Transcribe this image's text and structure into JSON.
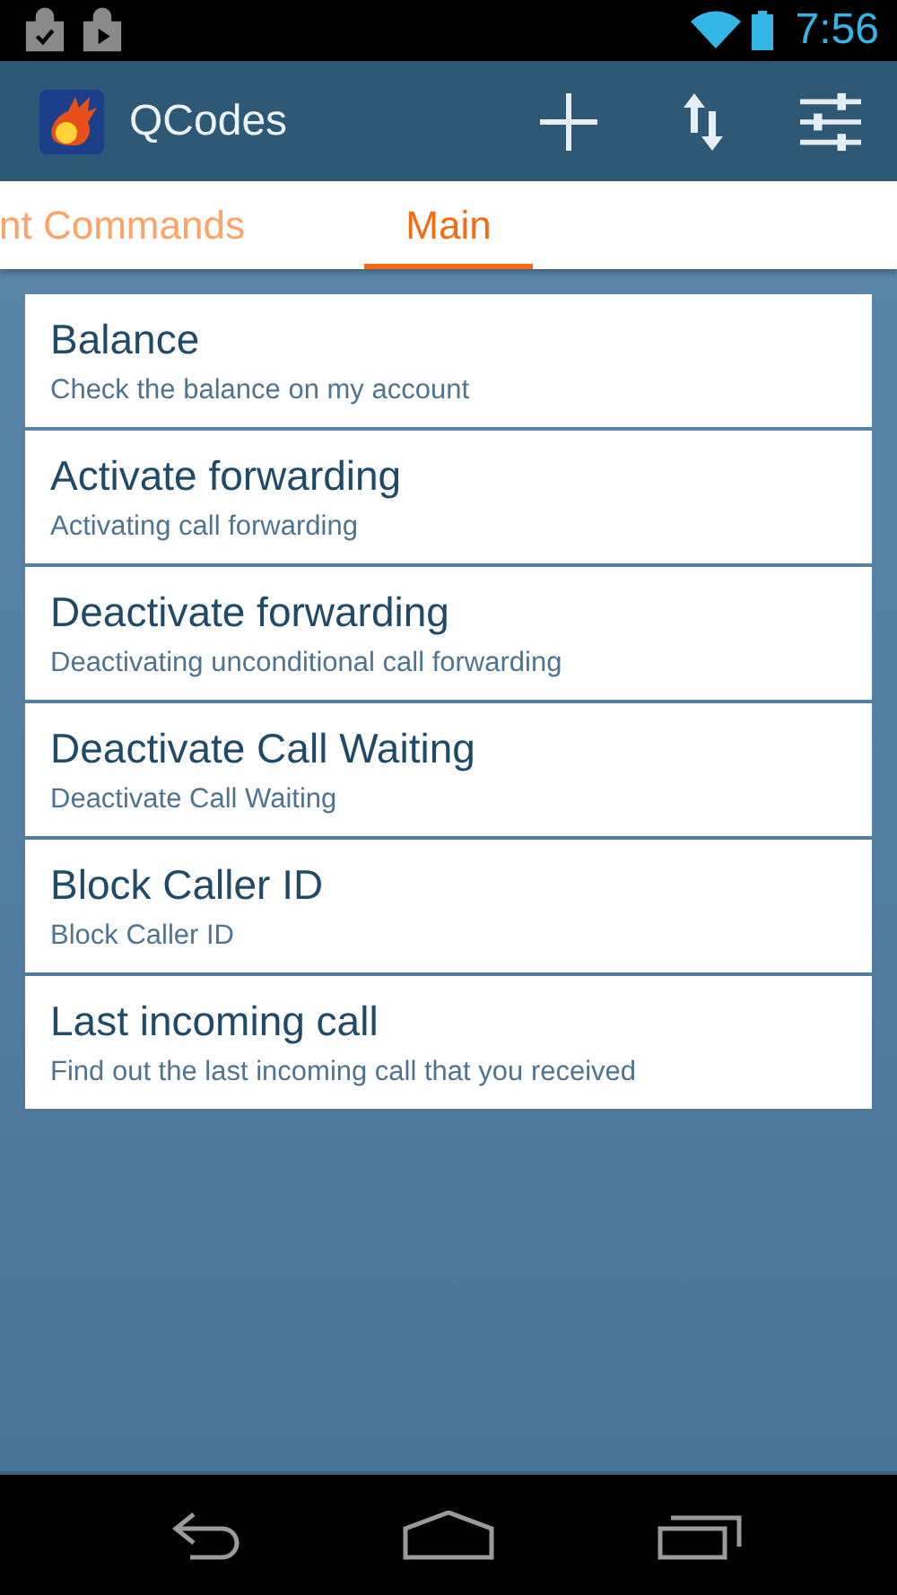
{
  "status_bar": {
    "time": "7:56"
  },
  "app_bar": {
    "title": "QCodes"
  },
  "tabs": [
    {
      "label": "nt Commands",
      "selected": false
    },
    {
      "label": "Main",
      "selected": true
    }
  ],
  "commands": [
    {
      "title": "Balance",
      "subtitle": "Check the balance on my account"
    },
    {
      "title": "Activate forwarding",
      "subtitle": "Activating call forwarding"
    },
    {
      "title": "Deactivate forwarding",
      "subtitle": "Deactivating unconditional call forwarding"
    },
    {
      "title": "Deactivate Call Waiting",
      "subtitle": "Deactivate Call Waiting"
    },
    {
      "title": "Block Caller ID",
      "subtitle": "Block Caller ID"
    },
    {
      "title": "Last incoming call",
      "subtitle": "Find out the last incoming call that you received"
    }
  ]
}
